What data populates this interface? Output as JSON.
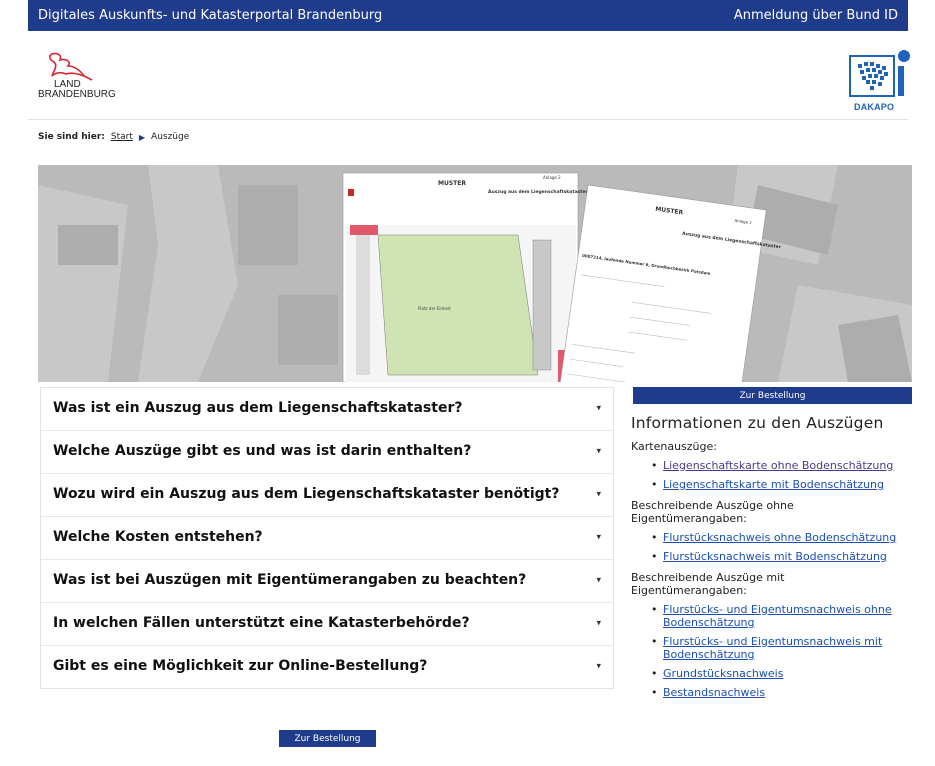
{
  "topbar": {
    "title": "Digitales Auskunfts- und Katasterportal Brandenburg",
    "login": "Anmeldung über Bund ID"
  },
  "logos": {
    "left_line1": "LAND",
    "left_line2": "BRANDENBURG",
    "right": "DAKAPO"
  },
  "breadcrumb": {
    "label": "Sie sind hier:",
    "start": "Start",
    "current": "Auszüge"
  },
  "hero": {
    "doc1_stamp": "MUSTER",
    "doc1_annex": "Anlage 2",
    "doc1_title": "Auszug aus dem Liegenschaftskataster",
    "doc1_place": "Platz der Einheit",
    "doc2_stamp": "MUSTER",
    "doc2_annex": "Anlage 1",
    "doc2_title": "Auszug aus dem Liegenschaftskataster",
    "doc2_line": "0007214, laufende Nummer 6, Grundbuchbezirk Potsdam"
  },
  "faq": [
    {
      "q": "Was ist ein Auszug aus dem Liegenschaftskataster?"
    },
    {
      "q": "Welche Auszüge gibt es und was ist darin enthalten?"
    },
    {
      "q": "Wozu wird ein Auszug aus dem Liegenschaftskataster benötigt?"
    },
    {
      "q": "Welche Kosten entstehen?"
    },
    {
      "q": "Was ist bei Auszügen mit Eigentümerangaben zu beachten?"
    },
    {
      "q": "In welchen Fällen unterstützt eine Katasterbehörde?"
    },
    {
      "q": "Gibt es eine Möglichkeit zur Online-Bestellung?"
    }
  ],
  "order_button": "Zur Bestellung",
  "info": {
    "title": "Informationen zu den Auszügen",
    "groups": [
      {
        "label": "Kartenauszüge:",
        "links": [
          "Liegenschaftskarte ohne Bodenschätzung",
          "Liegenschaftskarte mit Bodenschätzung"
        ]
      },
      {
        "label": "Beschreibende Auszüge ohne Eigentümerangaben:",
        "links": [
          "Flurstücksnachweis ohne Bodenschätzung",
          "Flurstücksnachweis mit Bodenschätzung"
        ]
      },
      {
        "label": "Beschreibende Auszüge mit Eigentümerangaben:",
        "links": [
          "Flurstücks- und Eigentumsnachweis ohne Bodenschätzung",
          "Flurstücks- und Eigentumsnachweis mit Bodenschätzung",
          "Grundstücksnachweis",
          "Bestandsnachweis"
        ]
      }
    ]
  },
  "colors": {
    "brand_blue": "#1f3b8c",
    "link_blue": "#1c4fb0",
    "eagle_red": "#d6262f"
  }
}
